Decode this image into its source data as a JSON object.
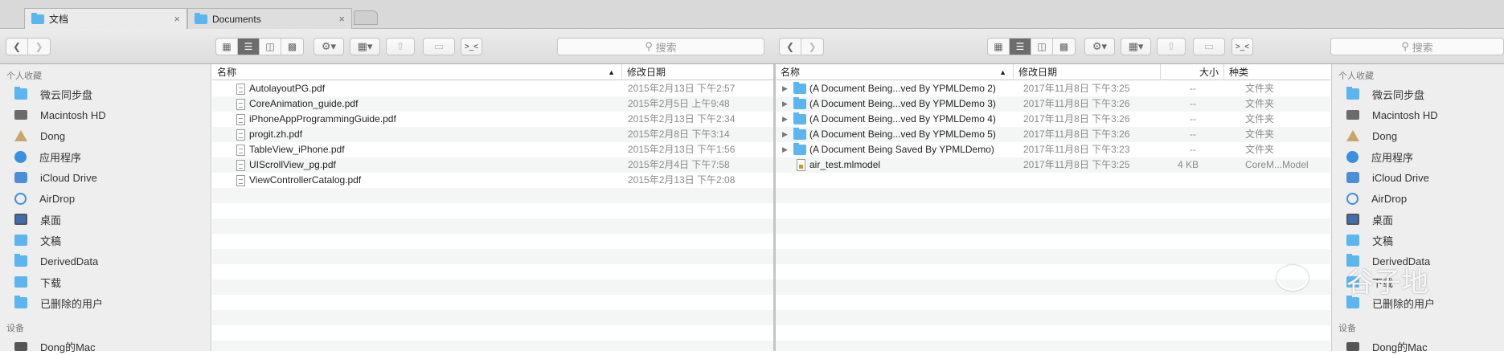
{
  "tabs": [
    {
      "label": "文档",
      "close": "×"
    },
    {
      "label": "Documents",
      "close": "×"
    }
  ],
  "search_label": "搜索",
  "sidebar": {
    "favorites_header": "个人收藏",
    "devices_header": "设备",
    "items": [
      {
        "label": "微云同步盘",
        "icon": "folder-icon"
      },
      {
        "label": "Macintosh HD",
        "icon": "disk-icon"
      },
      {
        "label": "Dong",
        "icon": "home-icon"
      },
      {
        "label": "应用程序",
        "icon": "app-icon"
      },
      {
        "label": "iCloud Drive",
        "icon": "cloud-icon"
      },
      {
        "label": "AirDrop",
        "icon": "airdrop-icon"
      },
      {
        "label": "桌面",
        "icon": "desktop-icon"
      },
      {
        "label": "文稿",
        "icon": "document-folder-icon"
      },
      {
        "label": "DerivedData",
        "icon": "folder-icon"
      },
      {
        "label": "下载",
        "icon": "download-icon"
      },
      {
        "label": "已删除的用户",
        "icon": "folder-icon"
      }
    ],
    "device": "Dong的Mac"
  },
  "left_pane": {
    "col_name": "名称",
    "col_date": "修改日期",
    "files": [
      {
        "name": "AutolayoutPG.pdf",
        "date": "2015年2月13日 下午2:57"
      },
      {
        "name": "CoreAnimation_guide.pdf",
        "date": "2015年2月5日 上午9:48"
      },
      {
        "name": "iPhoneAppProgrammingGuide.pdf",
        "date": "2015年2月13日 下午2:34"
      },
      {
        "name": "progit.zh.pdf",
        "date": "2015年2月8日 下午3:14"
      },
      {
        "name": "TableView_iPhone.pdf",
        "date": "2015年2月13日 下午1:56"
      },
      {
        "name": "UIScrollView_pg.pdf",
        "date": "2015年2月4日 下午7:58"
      },
      {
        "name": "ViewControllerCatalog.pdf",
        "date": "2015年2月13日 下午2:08"
      }
    ]
  },
  "right_pane": {
    "col_name": "名称",
    "col_date": "修改日期",
    "col_size": "大小",
    "col_kind": "种类",
    "files": [
      {
        "name": "(A Document Being...ved By YPMLDemo 2)",
        "date": "2017年11月8日 下午3:25",
        "size": "--",
        "kind": "文件夹"
      },
      {
        "name": "(A Document Being...ved By YPMLDemo 3)",
        "date": "2017年11月8日 下午3:26",
        "size": "--",
        "kind": "文件夹"
      },
      {
        "name": "(A Document Being...ved By YPMLDemo 4)",
        "date": "2017年11月8日 下午3:26",
        "size": "--",
        "kind": "文件夹"
      },
      {
        "name": "(A Document Being...ved By YPMLDemo 5)",
        "date": "2017年11月8日 下午3:26",
        "size": "--",
        "kind": "文件夹"
      },
      {
        "name": "(A Document Being Saved By YPMLDemo)",
        "date": "2017年11月8日 下午3:23",
        "size": "--",
        "kind": "文件夹"
      },
      {
        "name": "air_test.mlmodel",
        "date": "2017年11月8日 下午3:25",
        "size": "4 KB",
        "kind": "CoreM...Model"
      }
    ]
  },
  "watermark": "谷子地"
}
